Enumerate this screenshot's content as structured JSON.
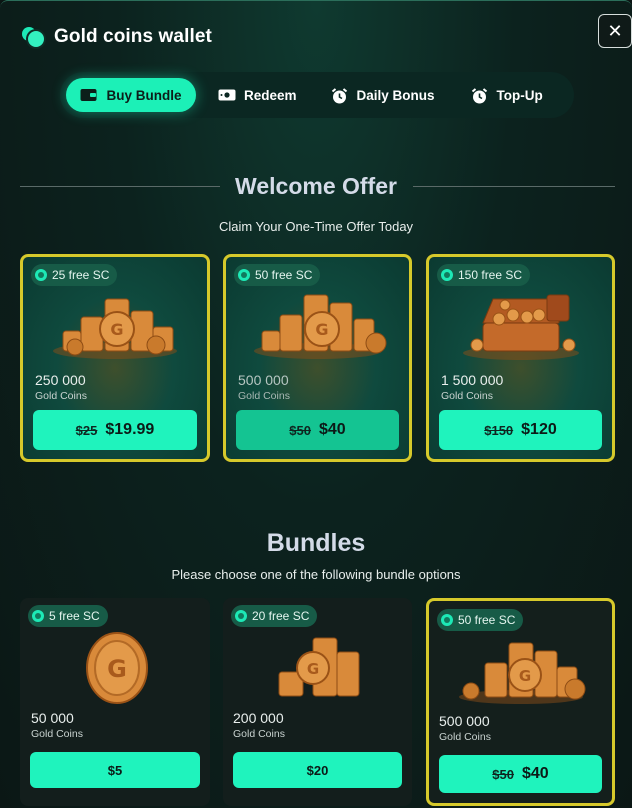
{
  "header": {
    "title": "Gold coins wallet",
    "close": "✕"
  },
  "tabs": [
    {
      "label": "Buy Bundle",
      "icon": "wallet-icon",
      "active": true
    },
    {
      "label": "Redeem",
      "icon": "cash-icon",
      "active": false
    },
    {
      "label": "Daily Bonus",
      "icon": "alarm-clock-icon",
      "active": false
    },
    {
      "label": "Top-Up",
      "icon": "alarm-clock-icon",
      "active": false
    }
  ],
  "welcome": {
    "title": "Welcome Offer",
    "subtitle": "Claim Your One-Time Offer Today",
    "cards": [
      {
        "badge": "25 free SC",
        "amount": "250 000",
        "unit": "Gold Coins",
        "old_price": "$25",
        "price": "$19.99"
      },
      {
        "badge": "50 free SC",
        "amount": "500 000",
        "unit": "Gold Coins",
        "old_price": "$50",
        "price": "$40"
      },
      {
        "badge": "150 free SC",
        "amount": "1 500 000",
        "unit": "Gold Coins",
        "old_price": "$150",
        "price": "$120"
      }
    ]
  },
  "bundles": {
    "title": "Bundles",
    "subtitle": "Please choose one of the following bundle options",
    "cards": [
      {
        "badge": "5 free SC",
        "amount": "50 000",
        "unit": "Gold Coins",
        "price": "$5"
      },
      {
        "badge": "20 free SC",
        "amount": "200 000",
        "unit": "Gold Coins",
        "price": "$20"
      },
      {
        "badge": "50 free SC",
        "amount": "500 000",
        "unit": "Gold Coins",
        "old_price": "$50",
        "price": "$40"
      }
    ]
  },
  "colors": {
    "accent": "#1ff3bd",
    "highlight_border": "#d6c92b",
    "coin_gold": "#d98a3a"
  }
}
